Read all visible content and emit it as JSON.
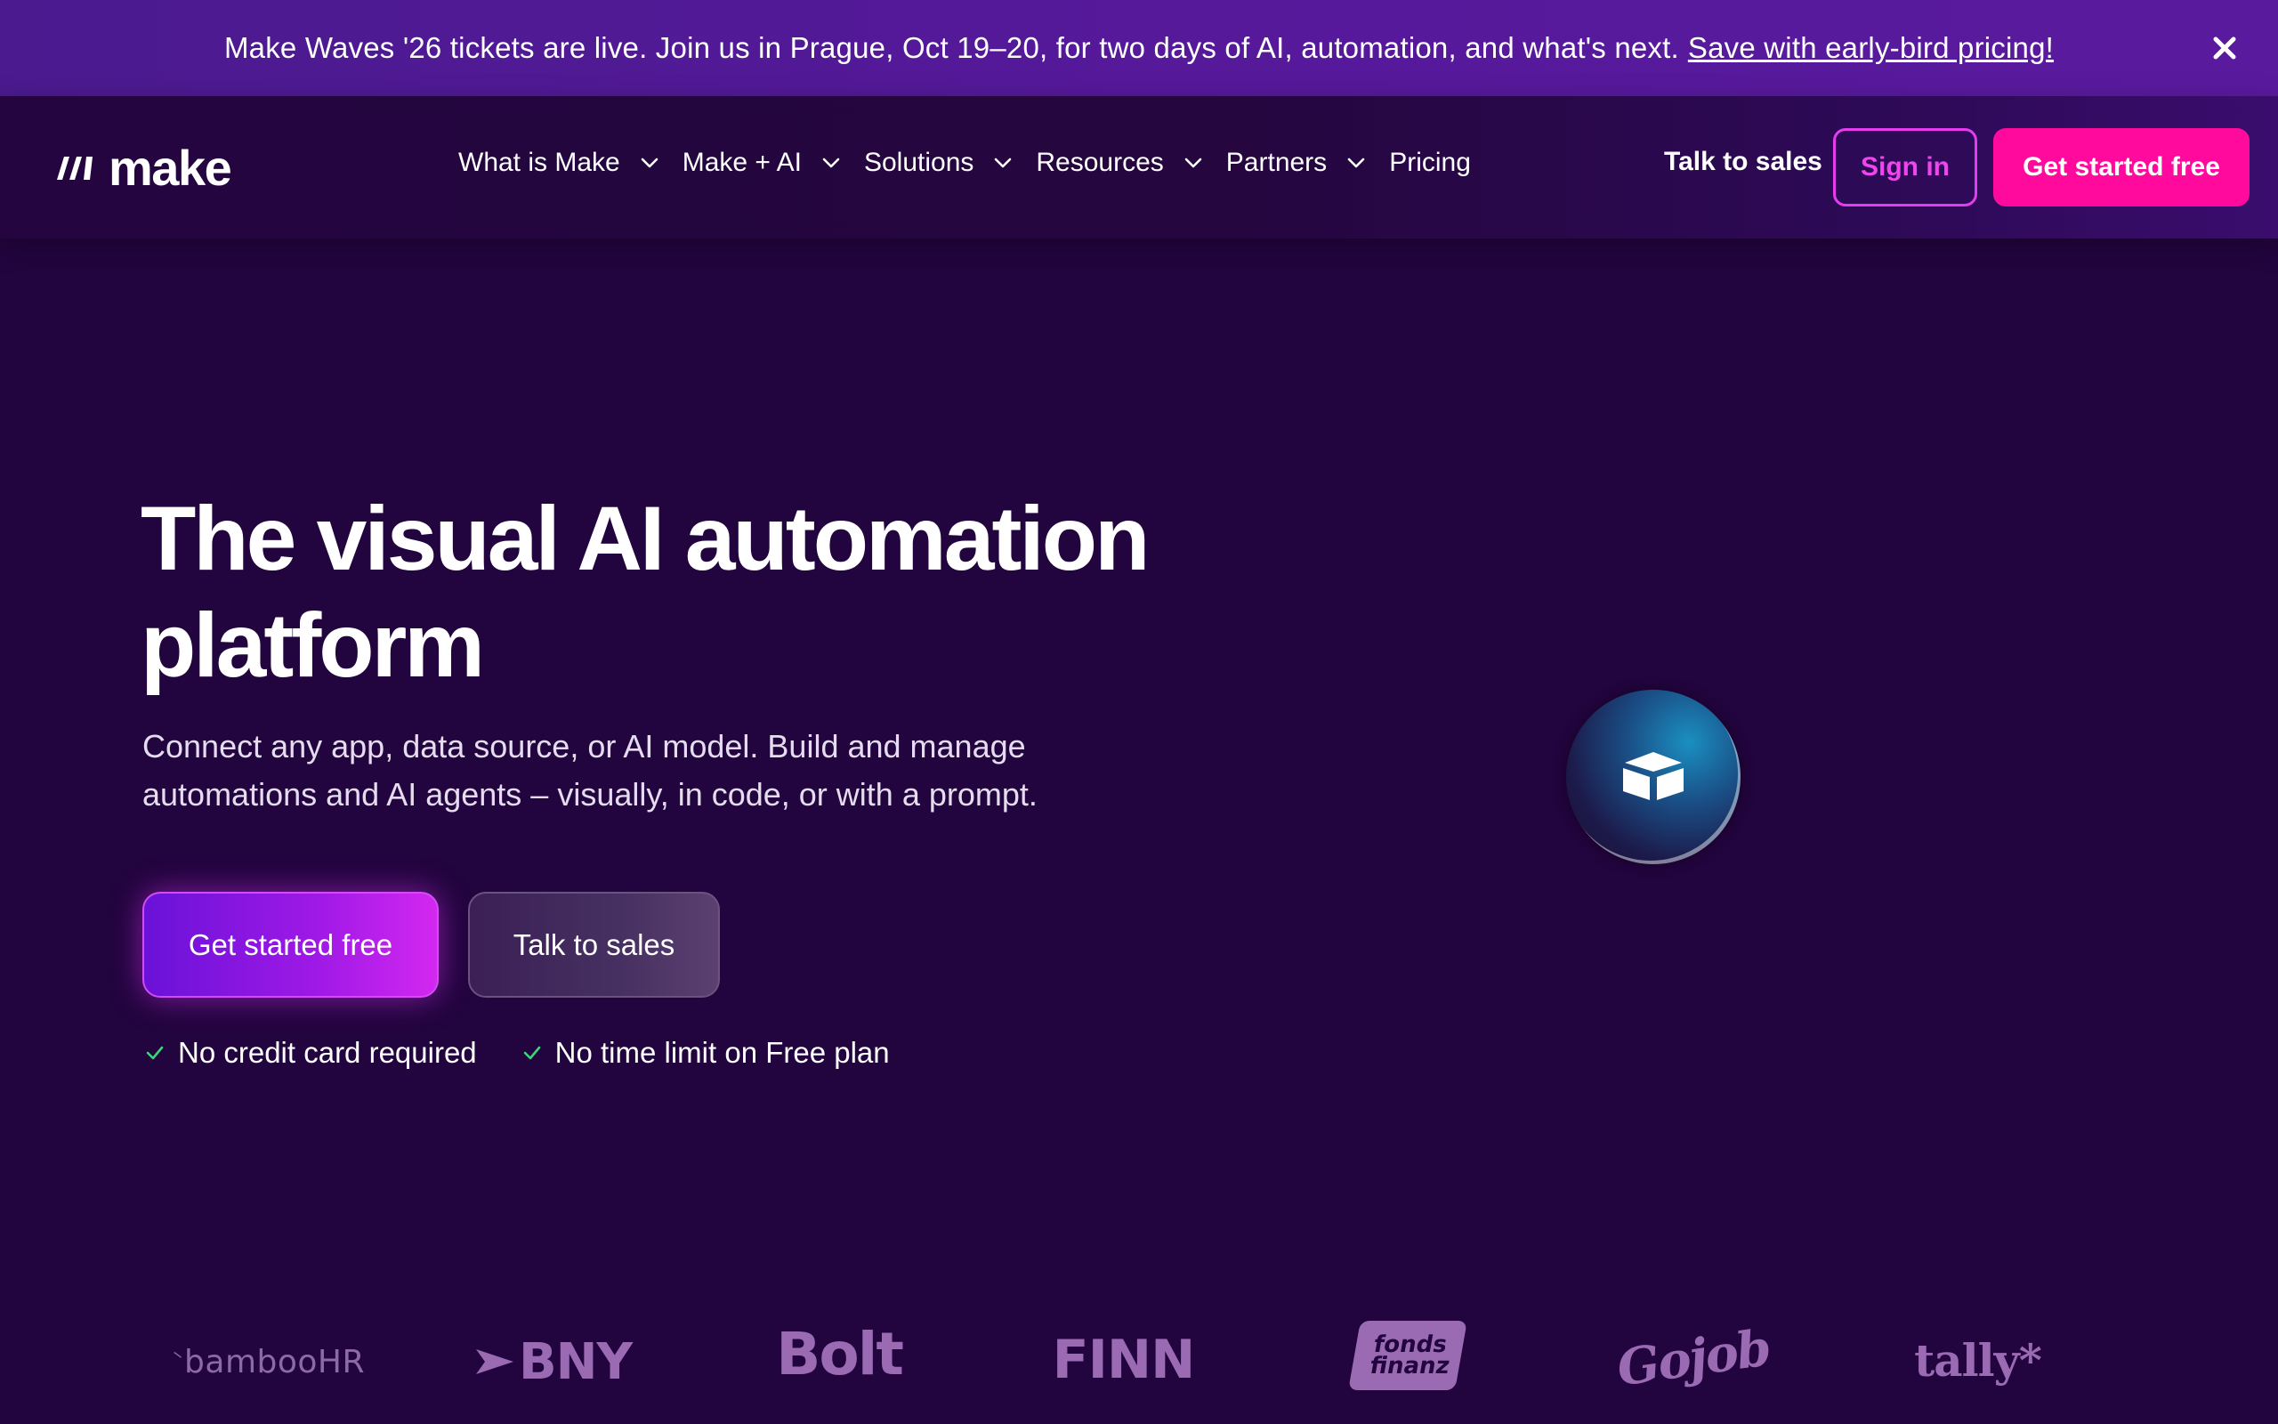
{
  "banner": {
    "message": "Make Waves '26 tickets are live. Join us in Prague, Oct 19–20, for two days of AI, automation, and what's next.",
    "cta_link": "Save with early-bird pricing!",
    "close_icon": "close-icon"
  },
  "nav": {
    "logo_text": "make",
    "items": [
      {
        "label": "What is Make",
        "has_dropdown": true
      },
      {
        "label": "Make + AI",
        "has_dropdown": true
      },
      {
        "label": "Solutions",
        "has_dropdown": true
      },
      {
        "label": "Resources",
        "has_dropdown": true
      },
      {
        "label": "Partners",
        "has_dropdown": true
      },
      {
        "label": "Pricing",
        "has_dropdown": false
      }
    ],
    "talk_to_sales": "Talk to sales",
    "sign_in": "Sign in",
    "get_started": "Get started free"
  },
  "hero": {
    "title_line1": "The visual AI automation",
    "title_line2": "platform",
    "subtitle_line1": "Connect any app, data source, or AI model. Build and manage",
    "subtitle_line2": "automations and AI agents – visually, in code, or with a prompt.",
    "primary_button": "Get started free",
    "secondary_button": "Talk to sales",
    "checks": [
      "No credit card required",
      "No time limit on Free plan"
    ]
  },
  "partner_logos": [
    {
      "name": "bamboohr",
      "text": "bambooHR"
    },
    {
      "name": "bny",
      "text": "BNY"
    },
    {
      "name": "bolt",
      "text": "Bolt"
    },
    {
      "name": "finn",
      "text": "FINN"
    },
    {
      "name": "fonds-finanz",
      "text": "fonds finanz"
    },
    {
      "name": "gojob",
      "text": "Gojob"
    },
    {
      "name": "tally",
      "text": "tally*"
    }
  ],
  "colors": {
    "background": "#22043e",
    "banner": "#55199a",
    "accent_pink": "#ff0a9c",
    "sign_in_border": "#e63cf0",
    "check_green": "#3ed37a",
    "logo_muted": "#9a6bb3"
  }
}
